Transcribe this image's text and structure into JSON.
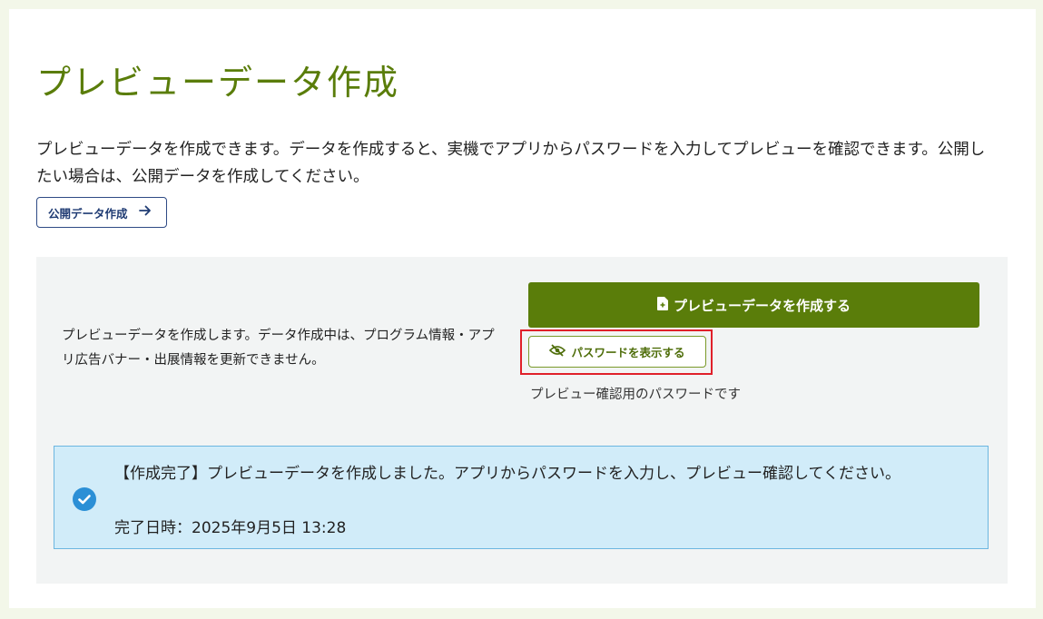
{
  "page": {
    "title": "プレビューデータ作成",
    "description": "プレビューデータを作成できます。データを作成すると、実機でアプリからパスワードを入力してプレビューを確認できます。公開したい場合は、公開データを作成してください。",
    "public_button_label": "公開データ作成"
  },
  "panel": {
    "text": "プレビューデータを作成します。データ作成中は、プログラム情報・アプリ広告バナー・出展情報を更新できません。",
    "create_button_label": "プレビューデータを作成する",
    "password_button_label": "パスワードを表示する",
    "password_note": "プレビュー確認用のパスワードです"
  },
  "alert": {
    "message": "【作成完了】プレビューデータを作成しました。アプリからパスワードを入力し、プレビュー確認してください。",
    "timestamp": "完了日時：2025年9月5日 13:28"
  },
  "icons": {
    "public_button": "arrow-right-icon",
    "create_button": "file-plus-icon",
    "password_button": "eye-slash-icon",
    "alert": "check-circle-icon"
  },
  "colors": {
    "brand_green": "#5a7d0a",
    "highlight_red": "#e0202a",
    "alert_background": "#d1ecf9",
    "alert_border": "#6cb6e0",
    "check_blue": "#2b8fd6",
    "link_navy": "#1f3b73"
  }
}
